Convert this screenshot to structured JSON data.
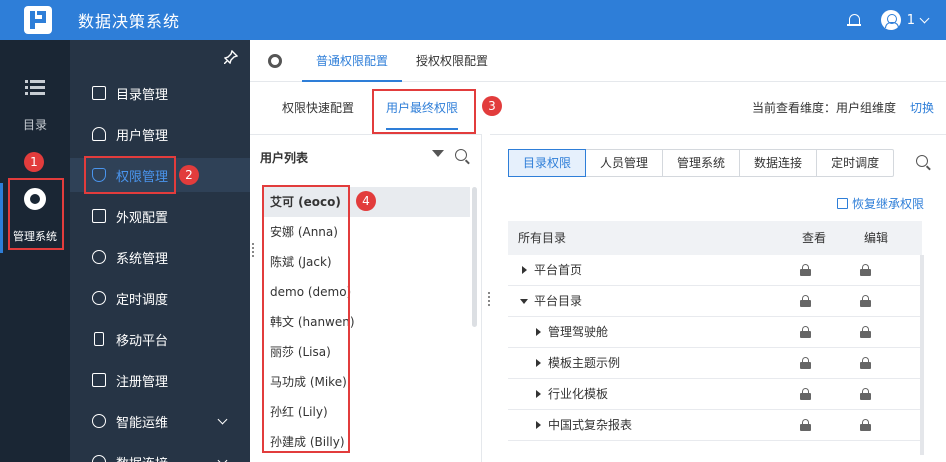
{
  "header": {
    "title": "数据决策系统",
    "user_name": "1"
  },
  "rail": {
    "items": [
      {
        "label": "目录",
        "icon": "list-icon"
      },
      {
        "label": "管理系统",
        "icon": "gear-icon"
      }
    ]
  },
  "sidebar": {
    "items": [
      {
        "label": "目录管理",
        "icon": "catalog-icon"
      },
      {
        "label": "用户管理",
        "icon": "user-icon"
      },
      {
        "label": "权限管理",
        "icon": "shield-icon"
      },
      {
        "label": "外观配置",
        "icon": "paint-icon"
      },
      {
        "label": "系统管理",
        "icon": "gear-icon"
      },
      {
        "label": "定时调度",
        "icon": "timer-icon"
      },
      {
        "label": "移动平台",
        "icon": "mobile-icon"
      },
      {
        "label": "注册管理",
        "icon": "register-icon"
      },
      {
        "label": "智能运维",
        "icon": "ops-icon"
      },
      {
        "label": "数据连接",
        "icon": "link-icon"
      }
    ]
  },
  "badges": [
    "1",
    "2",
    "3",
    "4"
  ],
  "main_tabs": [
    "普通权限配置",
    "授权权限配置"
  ],
  "sub_tabs": [
    "权限快速配置",
    "用户最终权限"
  ],
  "dimension": {
    "label": "当前查看维度：用户组维度",
    "switch": "切换"
  },
  "user_list": {
    "title": "用户列表",
    "users": [
      "艾可 (eoco)",
      "安娜 (Anna)",
      "陈斌 (Jack)",
      "demo (demo)",
      "韩文 (hanwen)",
      "丽莎 (Lisa)",
      "马功成 (Mike)",
      "孙红 (Lily)",
      "孙建成 (Billy)"
    ]
  },
  "perm": {
    "segments": [
      "目录权限",
      "人员管理",
      "管理系统",
      "数据连接",
      "定时调度"
    ],
    "restore": "恢复继承权限",
    "columns": [
      "所有目录",
      "查看",
      "编辑"
    ],
    "rows": [
      {
        "label": "平台首页",
        "expanded": false
      },
      {
        "label": "平台目录",
        "expanded": true
      },
      {
        "label": "管理驾驶舱",
        "expanded": false
      },
      {
        "label": "模板主题示例",
        "expanded": false
      },
      {
        "label": "行业化模板",
        "expanded": false
      },
      {
        "label": "中国式复杂报表",
        "expanded": false
      }
    ]
  },
  "colors": {
    "accent": "#2e7ed8",
    "annotation": "#e23c3c",
    "sidebar": "#263445",
    "rail": "#1a2634"
  }
}
